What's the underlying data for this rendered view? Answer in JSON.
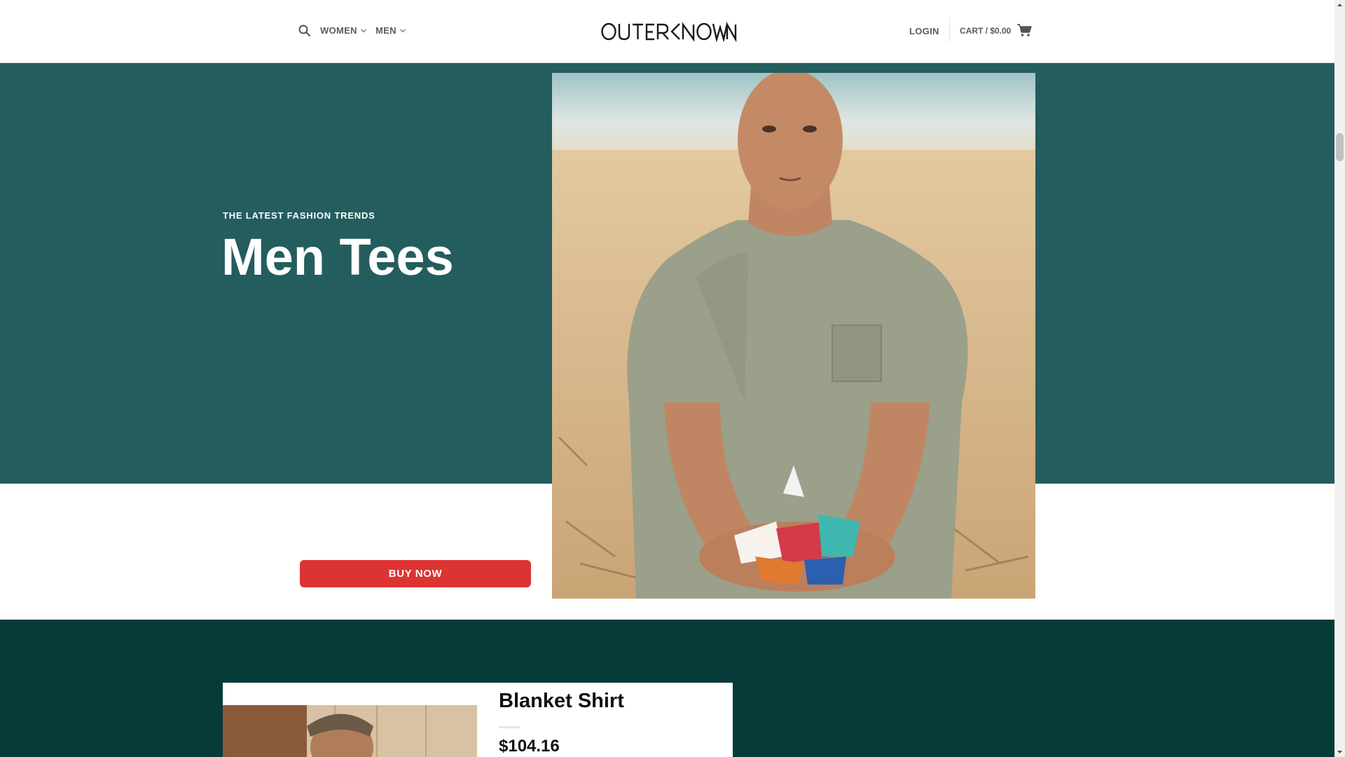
{
  "header": {
    "logo_text": "OUTERKNOWN",
    "nav": [
      {
        "label": "WOMEN"
      },
      {
        "label": "MEN"
      }
    ],
    "login_label": "LOGIN",
    "cart_label": "CART / $0.00",
    "icons": {
      "search": "search-icon",
      "cart": "shopping-cart-icon",
      "chevron": "chevron-down-icon"
    }
  },
  "hero": {
    "tagline": "THE LATEST FASHION TRENDS",
    "title": "Men Tees",
    "button_label": "BUY NOW",
    "colors": {
      "background": "#245d5e",
      "button": "#dd3333"
    }
  },
  "product": {
    "name": "Blanket Shirt",
    "price": "$104.16",
    "section_color": "#063b3a"
  }
}
